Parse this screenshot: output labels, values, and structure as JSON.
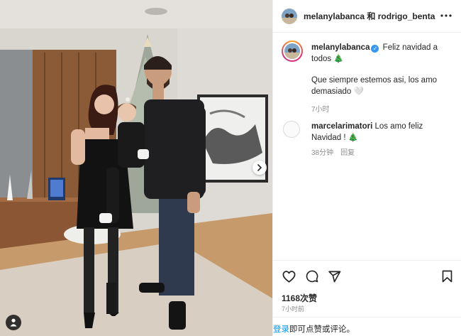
{
  "header": {
    "title": "melanylabanca 和 rodrigo_benta",
    "more_icon": "more-horizontal-icon"
  },
  "caption": {
    "username": "melanylabanca",
    "verified": true,
    "text_line1": "Feliz navidad a todos 🎄",
    "text_line2": "Que siempre estemos asi, los amo demasiado 🤍",
    "time": "7小时"
  },
  "comment": {
    "username": "marcelarimatori",
    "text": "Los amo feliz Navidad ! 🎄",
    "time": "38分钟",
    "reply_label": "回复"
  },
  "actions": {
    "like_icon": "heart-icon",
    "comment_icon": "comment-icon",
    "share_icon": "send-icon",
    "save_icon": "bookmark-icon"
  },
  "stats": {
    "likes": "1168次赞",
    "time": "7小时前"
  },
  "login_prompt": {
    "link": "登录",
    "text": "即可点赞或评论。"
  },
  "colors": {
    "link_blue": "#0095f6",
    "verified_blue": "#3897f0",
    "secondary_text": "#8e8e8e"
  }
}
